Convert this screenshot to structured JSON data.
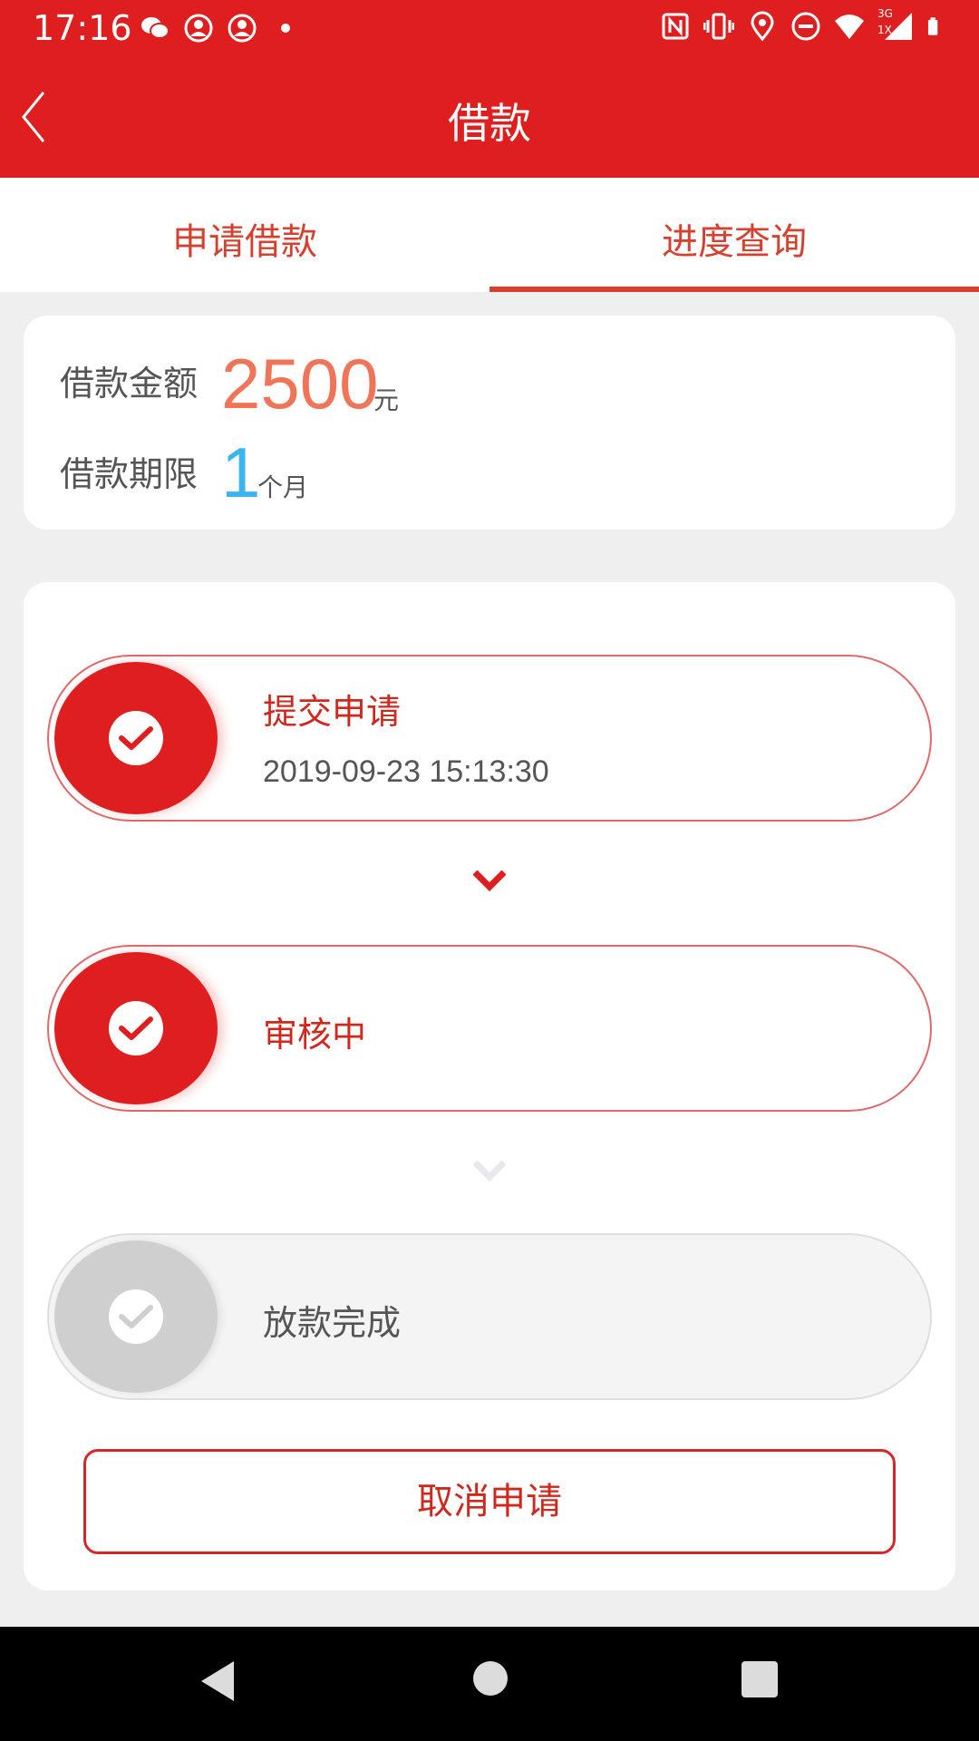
{
  "status_bar": {
    "time": "17:16",
    "notification_icons": [
      "wechat-icon",
      "contact-bell-icon",
      "contact-bell-icon",
      "dot-icon"
    ],
    "system_icons": [
      "nfc-icon",
      "vibrate-icon",
      "location-icon",
      "dnd-icon",
      "wifi-icon",
      "signal-icon",
      "battery-icon"
    ],
    "network_labels": [
      "3G",
      "1X"
    ]
  },
  "app_bar": {
    "title": "借款",
    "back_icon": "chevron-left-icon"
  },
  "tabs": [
    {
      "label": "申请借款",
      "active": false
    },
    {
      "label": "进度查询",
      "active": true
    }
  ],
  "loan_info": {
    "amount_label": "借款金额",
    "amount_value": "2500",
    "amount_unit": "元",
    "term_label": "借款期限",
    "term_value": "1",
    "term_unit": "个月"
  },
  "steps": [
    {
      "label": "提交申请",
      "date": "2019-09-23 15:13:30",
      "status": "done"
    },
    {
      "label": "审核中",
      "date": "",
      "status": "done"
    },
    {
      "label": "放款完成",
      "date": "",
      "status": "pending"
    }
  ],
  "cancel_button": {
    "label": "取消申请"
  },
  "colors": {
    "primary_red": "#df1f1f",
    "tab_red": "#d6412f",
    "amount_orange": "#ef7458",
    "term_blue": "#3cb4ef",
    "inactive_gray": "#cfcfcf"
  }
}
